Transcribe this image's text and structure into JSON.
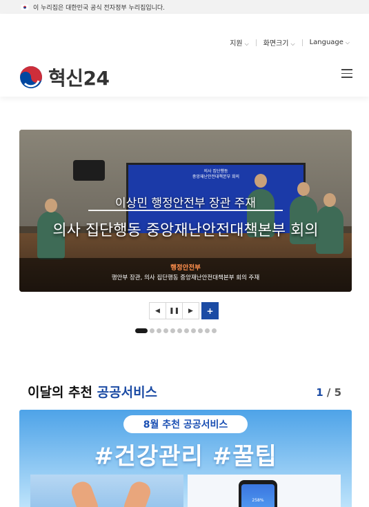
{
  "gov_bar": {
    "text": "이 누리집은 대한민국 공식 전자정부 누리집입니다."
  },
  "utils": {
    "support": "지원",
    "screen_size": "화면크기",
    "language": "Language"
  },
  "logo": {
    "text": "혁신24"
  },
  "slider": {
    "screen_text_1": "의사 집단행동",
    "screen_text_2": "중앙재난안전대책본부 회의",
    "caption_1": "이상민 행정안전부 장관 주재",
    "caption_2": "의사 집단행동 중앙재난안전대책본부 회의",
    "overlay_title": "행정안전부",
    "overlay_desc": "행안부 장관, 의사 집단행동 중앙재난안전대책본부 회의 주재",
    "dots_total": 11,
    "dots_active": 1
  },
  "section": {
    "title_plain": "이달의 추천",
    "title_accent": "공공서비스",
    "page_current": "1",
    "page_sep": " / ",
    "page_total": "5"
  },
  "banner": {
    "pill": "8월 추천 공공서비스",
    "headline": "#건강관리 #꿀팁",
    "phone_value": "258%"
  },
  "colors": {
    "accent": "#1b4ba4",
    "overlay_title": "#ff8f4d"
  }
}
